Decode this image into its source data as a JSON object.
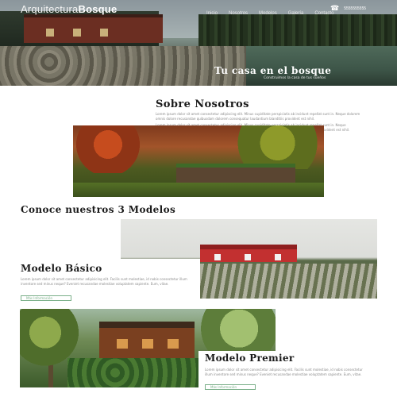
{
  "header": {
    "logo_light": "Arquitectura",
    "logo_bold": "Bosque",
    "phone": "5555555555",
    "phone_icon": "phone-icon",
    "menu": [
      {
        "label": "Inicio"
      },
      {
        "label": "Nosotros"
      },
      {
        "label": "Modelos"
      },
      {
        "label": "Galería"
      },
      {
        "label": "Contacto"
      }
    ]
  },
  "hero": {
    "title": "Tu casa en el bosque",
    "subtitle": "Construimos la casa de tus sueños"
  },
  "about": {
    "title": "Sobre Nosotros",
    "paragraphs": [
      "Lorem ipsum dolor sit amet consectetur adipiscing elit. Minus cupiditate perspiciatis ab incidunt repellat sunt in. Neque dolorem omnis dolore recusandae quibusdam dolorem consequatur laudantium blanditiis provident est nihil.",
      "Lorem ipsum dolor sit amet consectetur adipiscing elit. Minus cupiditate perspiciatis ab incidunt repellat sunt in. Neque quibusdam accusamus dolore dolor incidunt dolorem omnis dolore recusandae quibusdam laudantium provident est nihil."
    ]
  },
  "models": {
    "section_title": "Conoce nuestros 3 Modelos",
    "items": [
      {
        "title": "Modelo Básico",
        "text": "Lorem ipsum dolor sit amet consectetur adipisicing elit. Facilis sunt molestiae, id nobis consectetur illum inventore sed minus neque? Eveniet recusandae molestiae voluptatem sapiente. Eum, vitae.",
        "button": "Más Información"
      },
      {
        "title": "Modelo Premier",
        "text": "Lorem ipsum dolor sit amet consectetur adipisicing elit. Facilis sunt molestiae, id nobis consectetur illum inventore sed minus neque? Eveniet recusandae molestiae voluptatem sapiente. Eum, vitae.",
        "button": "Más Información"
      }
    ]
  },
  "colors": {
    "accent": "#7bb08a",
    "heading": "#1a1a1a",
    "body_text": "#8a8a8a"
  }
}
